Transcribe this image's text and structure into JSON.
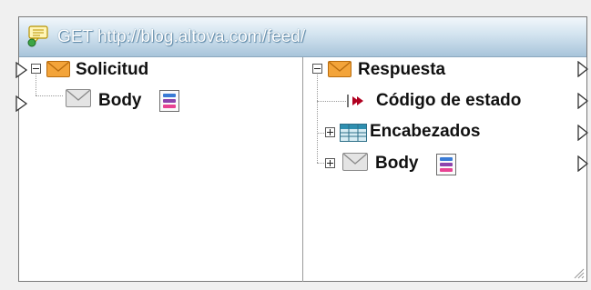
{
  "window": {
    "title": "GET http://blog.altova.com/feed/",
    "title_icon": "speech-bubble-icon"
  },
  "request": {
    "root_label": "Solicitud",
    "body_label": "Body"
  },
  "response": {
    "root_label": "Respuesta",
    "status_label": "Código de estado",
    "headers_label": "Encabezados",
    "body_label": "Body"
  },
  "colors": {
    "envelope_orange": "#f3a43a",
    "titlebar_blue": "#a8c4da",
    "status_arrow": "#b00020"
  }
}
